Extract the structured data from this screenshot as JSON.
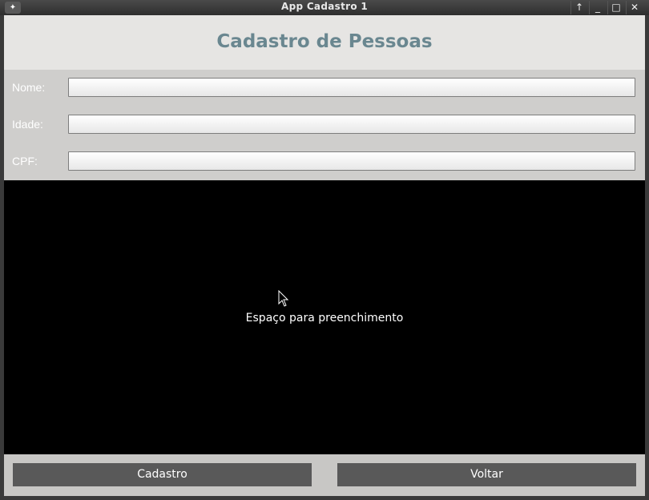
{
  "window": {
    "title": "App Cadastro 1",
    "buttons": {
      "up_icon": "arrow-up-icon",
      "minimize": "_",
      "maximize": "□",
      "close": "✕"
    }
  },
  "header": {
    "title": "Cadastro de Pessoas"
  },
  "form": {
    "fields": [
      {
        "label": "Nome:",
        "value": "",
        "placeholder": ""
      },
      {
        "label": "Idade:",
        "value": "",
        "placeholder": ""
      },
      {
        "label": "CPF:",
        "value": "",
        "placeholder": ""
      }
    ]
  },
  "content": {
    "message": "Espaço para preenchimento"
  },
  "footer": {
    "cadastro_label": "Cadastro",
    "voltar_label": "Voltar"
  },
  "colors": {
    "header_text": "#6a8790",
    "form_bg": "#cfcecc",
    "content_bg": "#000000",
    "button_bg": "#595959"
  }
}
